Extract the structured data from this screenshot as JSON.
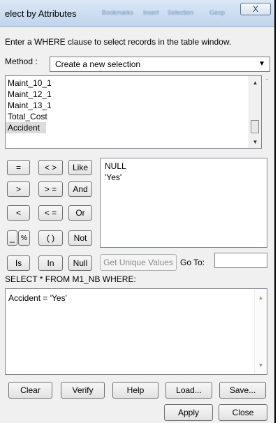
{
  "window": {
    "title": "elect by Attributes",
    "blurred_menu": [
      "Bookmarks",
      "Insert",
      "Selection",
      "Geop"
    ],
    "close_glyph": "X"
  },
  "instruction": "Enter a WHERE clause to select records in the table window.",
  "method": {
    "label": "Method :",
    "selected": "Create a new selection"
  },
  "fields": [
    "Maint_10_1",
    "Maint_12_1",
    "Maint_13_1",
    "Total_Cost",
    "Accident"
  ],
  "operators": {
    "eq": "=",
    "ne": "< >",
    "like": "Like",
    "gt": ">",
    "ge": "> =",
    "and": "And",
    "lt": "<",
    "le": "< =",
    "or": "Or",
    "underscore": "_",
    "percent": "%",
    "parens": "( )",
    "not": "Not",
    "is": "Is",
    "in": "In",
    "null": "Null"
  },
  "values": [
    "NULL",
    "'Yes'"
  ],
  "get_unique_values": "Get Unique Values",
  "goto_label": "Go To:",
  "goto_value": "",
  "sql_prefix": "SELECT * FROM M1_NB WHERE:",
  "expression": "Accident = 'Yes'",
  "buttons": {
    "clear": "Clear",
    "verify": "Verify",
    "help": "Help",
    "load": "Load...",
    "save": "Save...",
    "apply": "Apply",
    "close": "Close"
  }
}
